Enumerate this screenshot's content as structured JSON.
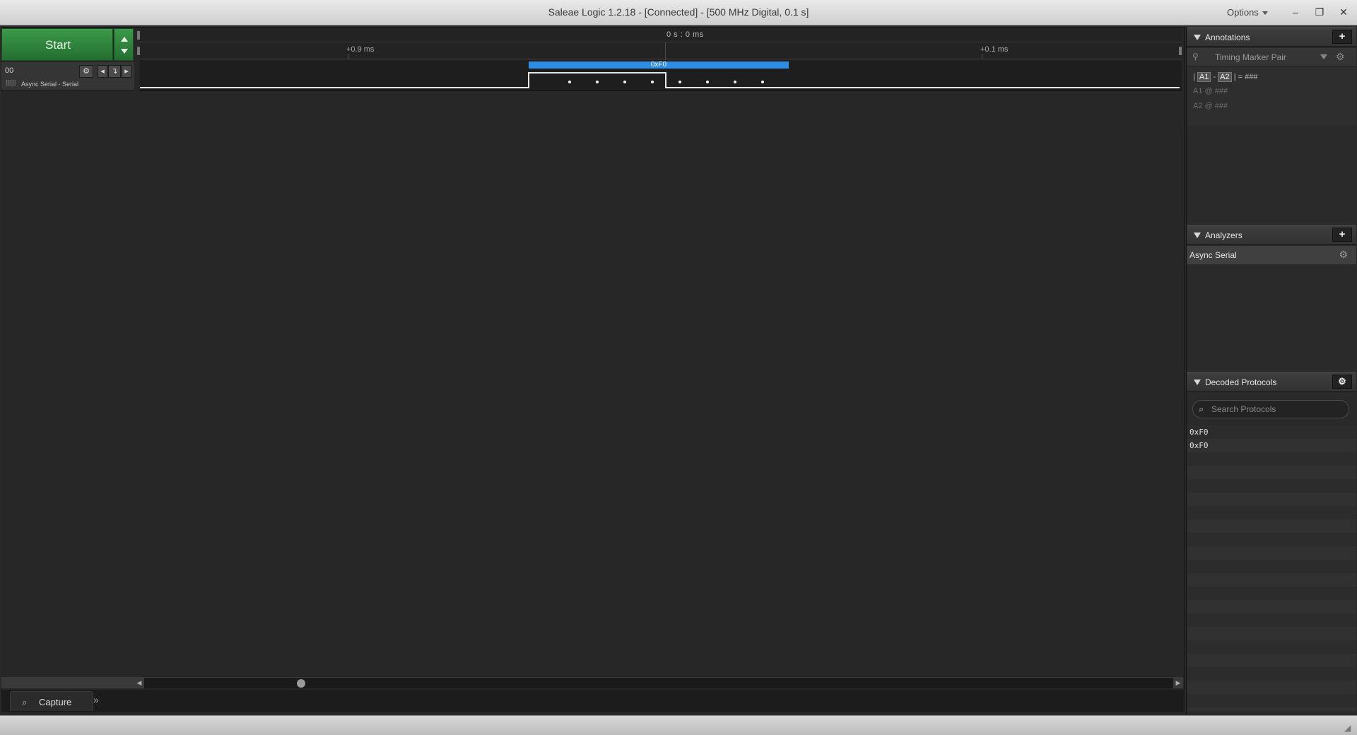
{
  "window": {
    "title": "Saleae Logic 1.2.18 - [Connected] - [500 MHz Digital, 0.1 s]",
    "options_label": "Options",
    "minimize": "–",
    "restore": "❐",
    "close": "✕"
  },
  "capture": {
    "start_label": "Start"
  },
  "channel": {
    "number": "00",
    "name": "Async Serial - Serial",
    "gear": "⚙",
    "prev": "◂",
    "edge": "↴",
    "next": "▸"
  },
  "timeline": {
    "center_time": "0 s : 0 ms",
    "left_label": "+0.9 ms",
    "right_label": "+0.1 ms"
  },
  "decoded_frame": {
    "value": "0xF0"
  },
  "tabs": {
    "capture": "Capture",
    "more": "»"
  },
  "panel": {
    "annotations": {
      "title": "Annotations",
      "add": "+",
      "marker_pair": "Timing Marker Pair",
      "formula": {
        "pipe_left": "|",
        "a1": "A1",
        "dash": "-",
        "a2": "A2",
        "rest": "| = ###"
      },
      "a1_line": "A1  @  ###",
      "a2_line": "A2  @  ###"
    },
    "analyzers": {
      "title": "Analyzers",
      "add": "+",
      "items": [
        "Async Serial"
      ]
    },
    "decoded_protocols": {
      "title": "Decoded Protocols",
      "search_placeholder": "Search Protocols",
      "rows": [
        "0xF0",
        "0xF0"
      ]
    }
  }
}
